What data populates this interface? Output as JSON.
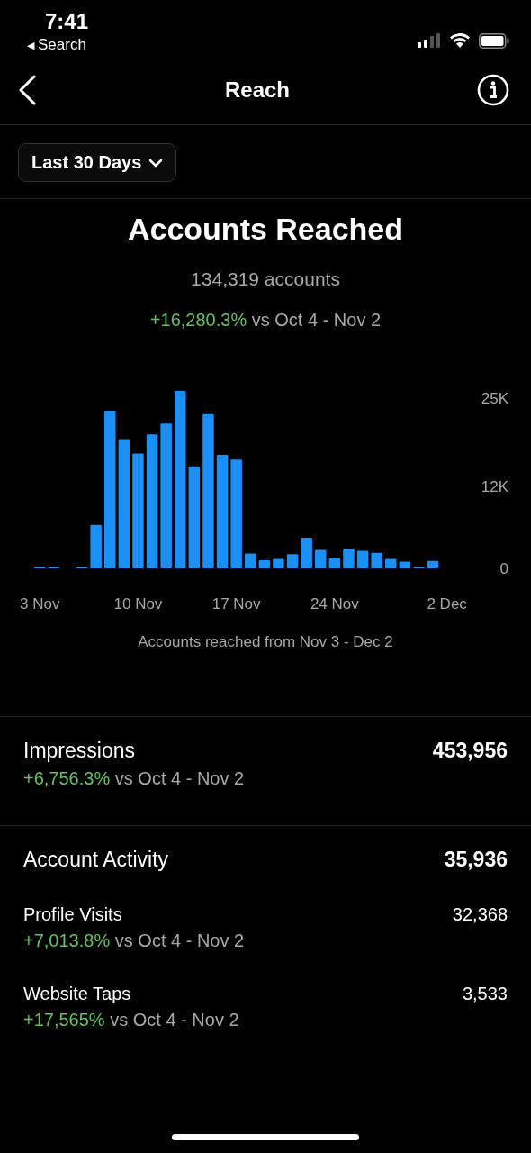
{
  "status_bar": {
    "time": "7:41",
    "back_glyph": "◀",
    "back_label": "Search"
  },
  "header": {
    "title": "Reach"
  },
  "filter": {
    "label": "Last 30 Days"
  },
  "reach": {
    "title": "Accounts Reached",
    "count": "134,319 accounts",
    "change": "+16,280.3%",
    "comparison": "vs Oct 4 - Nov 2",
    "chart_data": {
      "type": "bar",
      "categories": [
        "3 Nov",
        null,
        null,
        null,
        null,
        null,
        null,
        "10 Nov",
        null,
        null,
        null,
        null,
        null,
        null,
        "17 Nov",
        null,
        null,
        null,
        null,
        null,
        null,
        "24 Nov",
        null,
        null,
        null,
        null,
        null,
        null,
        null,
        "2 Dec"
      ],
      "values": [
        250,
        250,
        0,
        250,
        6400,
        23200,
        19000,
        16900,
        19700,
        21300,
        26100,
        15000,
        22700,
        16700,
        16000,
        2200,
        1200,
        1400,
        2100,
        4500,
        2700,
        1500,
        2900,
        2600,
        2300,
        1400,
        1000,
        250,
        1100,
        null
      ],
      "ylim": [
        0,
        26500
      ],
      "yticks": [
        {
          "value": 0,
          "label": "0"
        },
        {
          "value": 12000,
          "label": "12K"
        },
        {
          "value": 25000,
          "label": "25K"
        }
      ]
    },
    "caption": "Accounts reached from Nov 3 - Dec 2"
  },
  "impressions": {
    "label": "Impressions",
    "value": "453,956",
    "change": "+6,756.3%",
    "comparison": "vs Oct 4 - Nov 2"
  },
  "account_activity": {
    "label": "Account Activity",
    "value": "35,936",
    "items": [
      {
        "label": "Profile Visits",
        "value": "32,368",
        "change": "+7,013.8%",
        "comparison": "vs Oct 4 - Nov 2"
      },
      {
        "label": "Website Taps",
        "value": "3,533",
        "change": "+17,565%",
        "comparison": "vs Oct 4 - Nov 2"
      }
    ]
  }
}
